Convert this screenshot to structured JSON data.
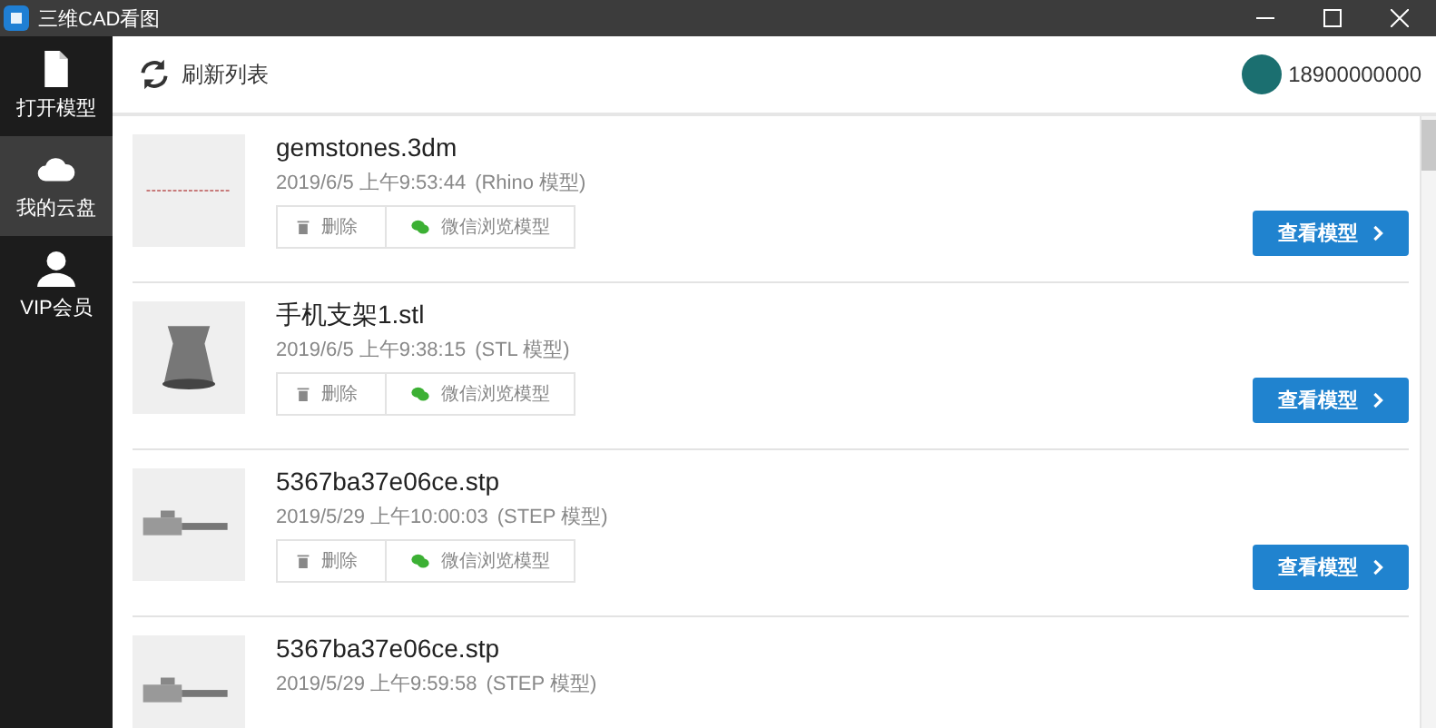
{
  "window": {
    "title": "三维CAD看图"
  },
  "sidebar": {
    "items": [
      {
        "label": "打开模型",
        "selected": false
      },
      {
        "label": "我的云盘",
        "selected": true
      },
      {
        "label": "VIP会员",
        "selected": false
      }
    ]
  },
  "toolbar": {
    "refresh": "刷新列表",
    "user": "18900000000"
  },
  "files": [
    {
      "name": "gemstones.3dm",
      "date": "2019/6/5 上午9:53:44",
      "type": "(Rhino 模型)",
      "actions": {
        "delete": "删除",
        "wechat": "微信浏览模型",
        "view": "查看模型"
      }
    },
    {
      "name": "手机支架1.stl",
      "date": "2019/6/5 上午9:38:15",
      "type": "(STL 模型)",
      "actions": {
        "delete": "删除",
        "wechat": "微信浏览模型",
        "view": "查看模型"
      }
    },
    {
      "name": "5367ba37e06ce.stp",
      "date": "2019/5/29 上午10:00:03",
      "type": "(STEP 模型)",
      "actions": {
        "delete": "删除",
        "wechat": "微信浏览模型",
        "view": "查看模型"
      }
    },
    {
      "name": "5367ba37e06ce.stp",
      "date": "2019/5/29 上午9:59:58",
      "type": "(STEP 模型)"
    }
  ]
}
